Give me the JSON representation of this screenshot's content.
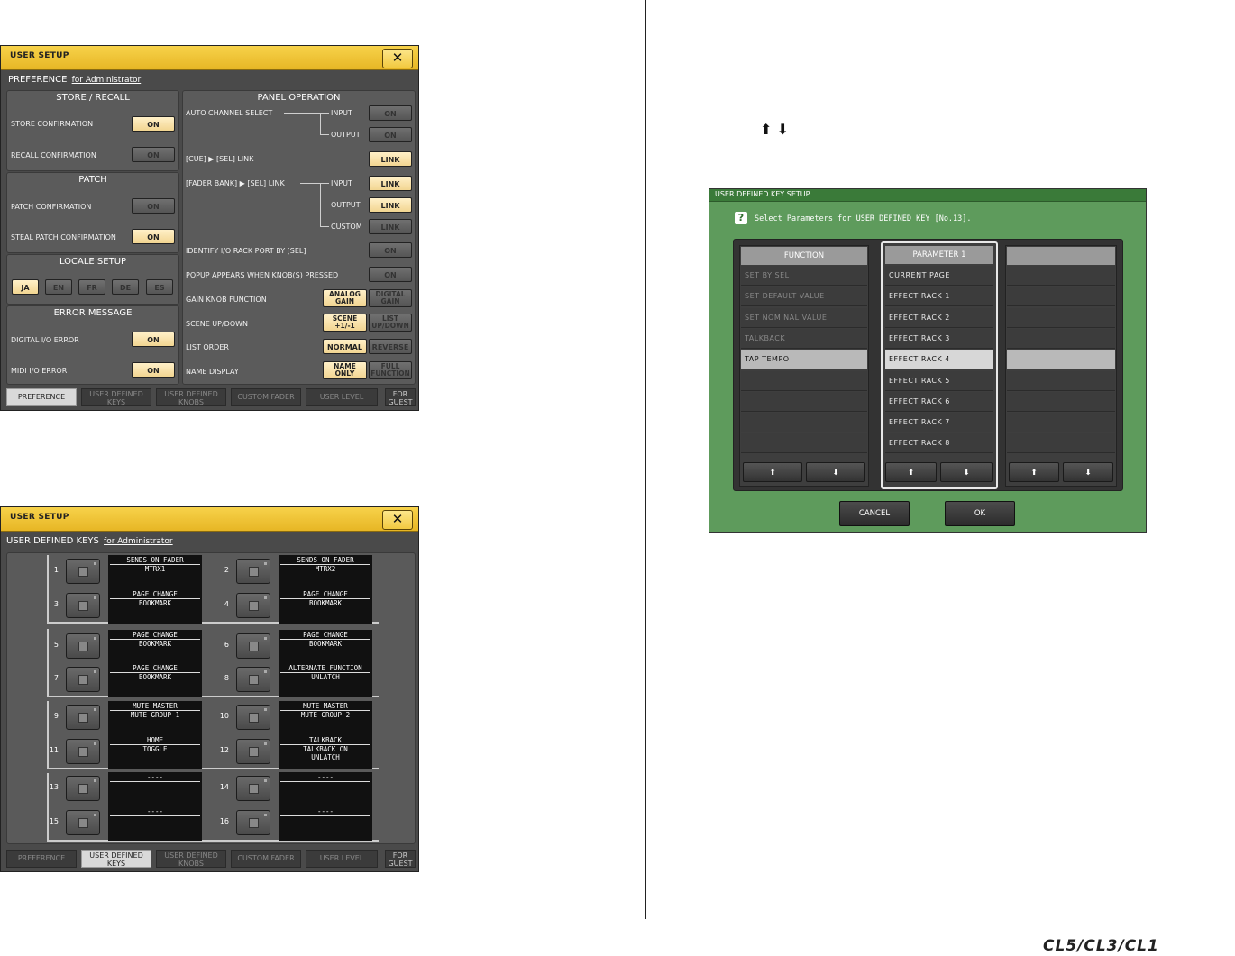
{
  "win1": {
    "title": "USER SETUP",
    "close": "✕",
    "preference_title": "PREFERENCE",
    "for_admin": "for Administrator",
    "store_recall": {
      "head": "STORE / RECALL",
      "store_conf": "STORE CONFIRMATION",
      "recall_conf": "RECALL CONFIRMATION"
    },
    "patch": {
      "head": "PATCH",
      "patch_conf": "PATCH CONFIRMATION",
      "steal_conf": "STEAL PATCH CONFIRMATION"
    },
    "locale": {
      "head": "LOCALE SETUP",
      "items": [
        "JA",
        "EN",
        "FR",
        "DE",
        "ES"
      ]
    },
    "error": {
      "head": "ERROR MESSAGE",
      "digital": "DIGITAL I/O ERROR",
      "midi": "MIDI I/O ERROR"
    },
    "panel": {
      "head": "PANEL OPERATION",
      "auto_ch": "AUTO CHANNEL SELECT",
      "input": "INPUT",
      "output": "OUTPUT",
      "custom": "CUSTOM",
      "cue_sel": "[CUE] ▶ [SEL] LINK",
      "fader_sel": "[FADER BANK] ▶ [SEL] LINK",
      "identify": "IDENTIFY I/O RACK PORT BY [SEL]",
      "popup": "POPUP APPEARS WHEN KNOB(S) PRESSED",
      "gain_knob": "GAIN KNOB FUNCTION",
      "scene_updown": "SCENE UP/DOWN",
      "list_order": "LIST ORDER",
      "name_display": "NAME DISPLAY"
    },
    "on": "ON",
    "link": "LINK",
    "analog_gain_1": "ANALOG",
    "analog_gain_2": "GAIN",
    "digital_gain_1": "DIGITAL",
    "digital_gain_2": "GAIN",
    "scene_1": "SCENE",
    "scene_2": "+1/-1",
    "list_1": "LIST",
    "list_2": "UP/DOWN",
    "normal": "NORMAL",
    "reverse": "REVERSE",
    "name_only_1": "NAME",
    "name_only_2": "ONLY",
    "full_1": "FULL",
    "full_2": "FUNCTION",
    "tabs": {
      "preference": "PREFERENCE",
      "udk_1": "USER DEFINED",
      "udk_2": "KEYS",
      "udkn_1": "USER DEFINED",
      "udkn_2": "KNOBS",
      "custom_fader": "CUSTOM FADER",
      "user_level": "USER LEVEL",
      "guest_1": "FOR",
      "guest_2": "GUEST"
    }
  },
  "win2": {
    "title": "USER SETUP",
    "close": "✕",
    "heading": "USER DEFINED KEYS",
    "for_admin": "for Administrator",
    "keys": [
      {
        "n": "1",
        "l1": "SENDS ON FADER",
        "l2": "MTRX1",
        "l3": ""
      },
      {
        "n": "2",
        "l1": "SENDS ON FADER",
        "l2": "MTRX2",
        "l3": ""
      },
      {
        "n": "3",
        "l1": "PAGE CHANGE",
        "l2": "BOOKMARK",
        "l3": ""
      },
      {
        "n": "4",
        "l1": "PAGE CHANGE",
        "l2": "BOOKMARK",
        "l3": ""
      },
      {
        "n": "5",
        "l1": "PAGE CHANGE",
        "l2": "BOOKMARK",
        "l3": ""
      },
      {
        "n": "6",
        "l1": "PAGE CHANGE",
        "l2": "BOOKMARK",
        "l3": ""
      },
      {
        "n": "7",
        "l1": "PAGE CHANGE",
        "l2": "BOOKMARK",
        "l3": ""
      },
      {
        "n": "8",
        "l1": "ALTERNATE FUNCTION",
        "l2": "UNLATCH",
        "l3": ""
      },
      {
        "n": "9",
        "l1": "MUTE MASTER",
        "l2": "MUTE GROUP 1",
        "l3": ""
      },
      {
        "n": "10",
        "l1": "MUTE MASTER",
        "l2": "MUTE GROUP 2",
        "l3": ""
      },
      {
        "n": "11",
        "l1": "HOME",
        "l2": "TOGGLE",
        "l3": ""
      },
      {
        "n": "12",
        "l1": "TALKBACK",
        "l2": "TALKBACK ON",
        "l3": "UNLATCH"
      },
      {
        "n": "13",
        "l1": "----",
        "l2": "",
        "l3": ""
      },
      {
        "n": "14",
        "l1": "----",
        "l2": "",
        "l3": ""
      },
      {
        "n": "15",
        "l1": "----",
        "l2": "",
        "l3": ""
      },
      {
        "n": "16",
        "l1": "----",
        "l2": "",
        "l3": ""
      }
    ]
  },
  "arrows_glyph": "⬆ ⬇",
  "udk": {
    "title": "USER DEFINED KEY SETUP",
    "help": "?",
    "instruction": "Select Parameters for USER DEFINED KEY [No.13].",
    "function_head": "FUNCTION",
    "param_head": "PARAMETER 1",
    "function_rows": [
      "SET BY SEL",
      "SET DEFAULT VALUE",
      "SET NOMINAL VALUE",
      "TALKBACK",
      "TAP TEMPO",
      "",
      "",
      "",
      ""
    ],
    "param_rows": [
      "CURRENT PAGE",
      "EFFECT RACK 1",
      "EFFECT RACK 2",
      "EFFECT RACK 3",
      "EFFECT RACK 4",
      "EFFECT RACK 5",
      "EFFECT RACK 6",
      "EFFECT RACK 7",
      "EFFECT RACK 8"
    ],
    "up": "⬆",
    "down": "⬇",
    "cancel": "CANCEL",
    "ok": "OK"
  },
  "footer_logo": "CL5/CL3/CL1"
}
